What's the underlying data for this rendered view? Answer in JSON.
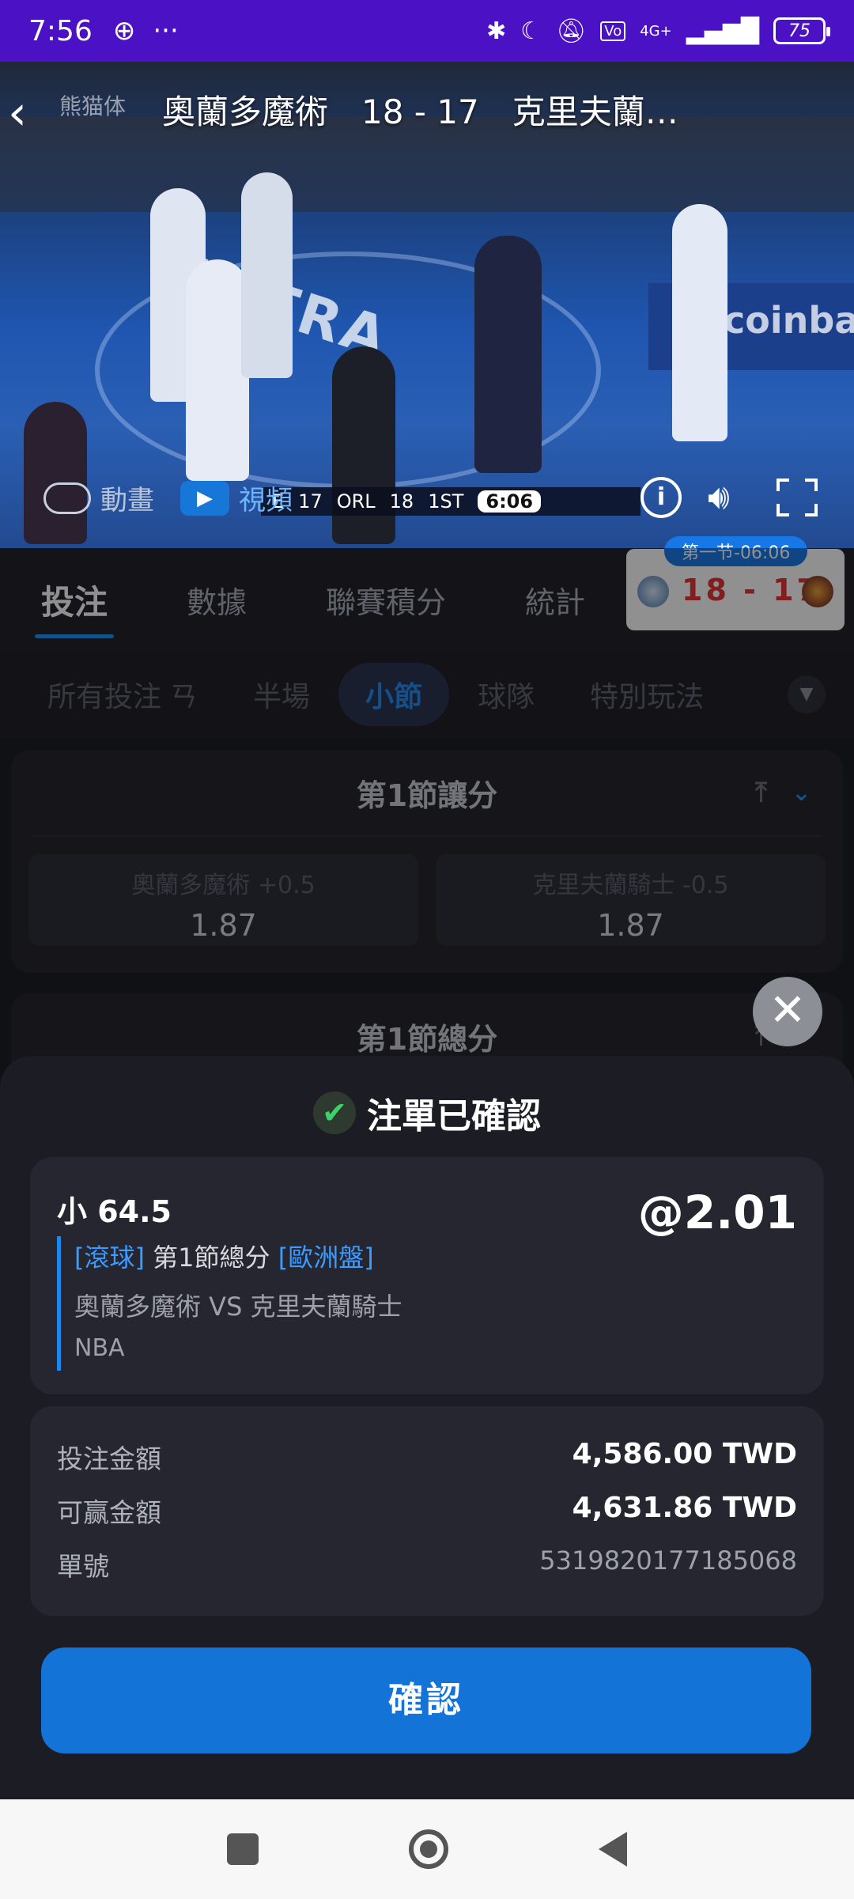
{
  "status_bar": {
    "time": "7:56",
    "more": "···",
    "network": "4G+",
    "battery": "75"
  },
  "video": {
    "title": "奧蘭多魔術　18 - 17　克里夫蘭…",
    "logo_text": "熊猫体",
    "ad_ultra": "ULTRA",
    "ad_coinbase": "coinbas",
    "scorebug": {
      "left_team": "E",
      "left_score": "17",
      "right_team": "ORL",
      "right_score": "18",
      "period": "1ST",
      "clock": "6:06"
    },
    "animation_label": "動畫",
    "video_label": "視頻"
  },
  "tabs": [
    "投注",
    "數據",
    "聯賽積分",
    "統計"
  ],
  "score_card": {
    "period": "第一节-06:06",
    "score": "18 - 17"
  },
  "subtabs": [
    "所有投注",
    "ㄢ",
    "半場",
    "小節",
    "球隊",
    "特別玩法"
  ],
  "markets": [
    {
      "title": "第1節讓分",
      "options": [
        {
          "label": "奧蘭多魔術 +0.5",
          "odds": "1.87"
        },
        {
          "label": "克里夫蘭騎士 -0.5",
          "odds": "1.87"
        }
      ]
    },
    {
      "title": "第1節總分"
    }
  ],
  "sheet": {
    "title": "注單已確認",
    "bet": {
      "pick": "小 64.5",
      "odds": "@2.01",
      "tag_live": "[滾球]",
      "market": "第1節總分",
      "tag_type": "[歐洲盤]",
      "match": "奧蘭多魔術 VS 克里夫蘭騎士",
      "league": "NBA"
    },
    "summary": [
      {
        "label": "投注金額",
        "value": "4,586.00 TWD"
      },
      {
        "label": "可赢金額",
        "value": "4,631.86 TWD"
      },
      {
        "label": "單號",
        "value": "5319820177185068"
      }
    ],
    "confirm_label": "確認"
  }
}
